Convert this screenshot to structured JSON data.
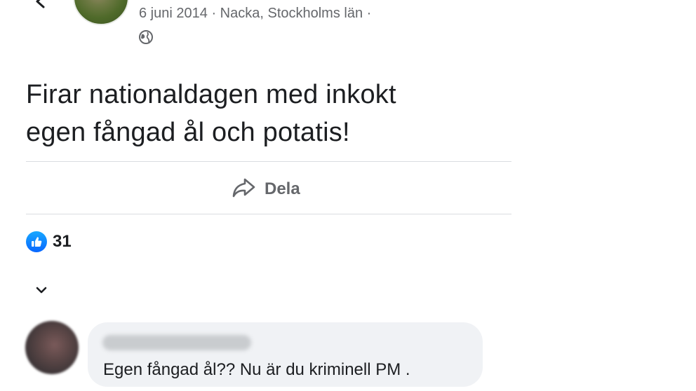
{
  "post": {
    "date": "6 juni 2014",
    "separator": "·",
    "location": "Nacka, Stockholms län",
    "text_line1": "Firar nationaldagen med inkokt",
    "text_line2": "egen fångad ål och potatis!"
  },
  "actions": {
    "share_label": "Dela"
  },
  "reactions": {
    "type": "like",
    "count": "31"
  },
  "comment": {
    "text": "Egen fångad ål?? Nu är du kriminell PM ."
  },
  "icons": {
    "back": "back-arrow-icon",
    "privacy": "globe-icon",
    "more": "more-dots-icon",
    "share": "share-arrow-icon",
    "like": "thumbs-up-icon",
    "sort": "chevron-down-icon"
  },
  "colors": {
    "like_blue": "#0866ff",
    "secondary_text": "#65676b",
    "comment_bubble": "#f0f2f5",
    "divider": "#dadde1"
  }
}
